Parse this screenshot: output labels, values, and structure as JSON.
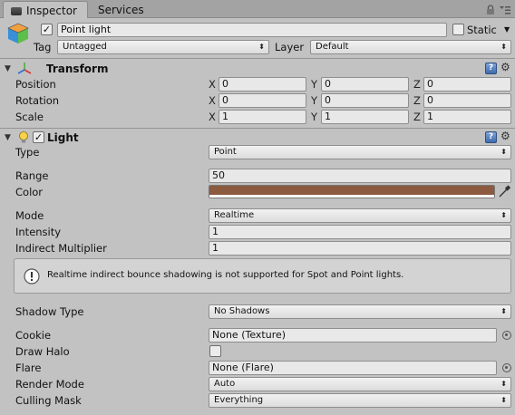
{
  "tabs": [
    {
      "label": "Inspector"
    },
    {
      "label": "Services"
    }
  ],
  "object": {
    "name": "Point light",
    "static_label": "Static",
    "tag_label": "Tag",
    "tag_value": "Untagged",
    "layer_label": "Layer",
    "layer_value": "Default",
    "active": true,
    "static": false
  },
  "transform": {
    "title": "Transform",
    "rows": [
      {
        "label": "Position",
        "x": "0",
        "y": "0",
        "z": "0"
      },
      {
        "label": "Rotation",
        "x": "0",
        "y": "0",
        "z": "0"
      },
      {
        "label": "Scale",
        "x": "1",
        "y": "1",
        "z": "1"
      }
    ],
    "axis_labels": [
      "X",
      "Y",
      "Z"
    ]
  },
  "light": {
    "title": "Light",
    "enabled": true,
    "type_label": "Type",
    "type_value": "Point",
    "range_label": "Range",
    "range_value": "50",
    "color_label": "Color",
    "color_value": "#8b5a3f",
    "mode_label": "Mode",
    "mode_value": "Realtime",
    "intensity_label": "Intensity",
    "intensity_value": "1",
    "indirect_label": "Indirect Multiplier",
    "indirect_value": "1",
    "warning_text": "Realtime indirect bounce shadowing is not supported for Spot and Point lights.",
    "shadow_label": "Shadow Type",
    "shadow_value": "No Shadows",
    "cookie_label": "Cookie",
    "cookie_value": "None (Texture)",
    "halo_label": "Draw Halo",
    "draw_halo": false,
    "flare_label": "Flare",
    "flare_value": "None (Flare)",
    "render_mode_label": "Render Mode",
    "render_mode_value": "Auto",
    "culling_label": "Culling Mask",
    "culling_value": "Everything"
  },
  "icons": {
    "lock": "lock-icon",
    "menu": "menu-icon",
    "gameobject": "gameobject-cube-icon",
    "transform": "transform-axes-icon",
    "light": "lightbulb-icon",
    "help": "help-icon",
    "gear": "gear-icon",
    "info": "info-icon",
    "eyedropper": "eyedropper-icon",
    "object_picker": "object-picker-icon"
  }
}
